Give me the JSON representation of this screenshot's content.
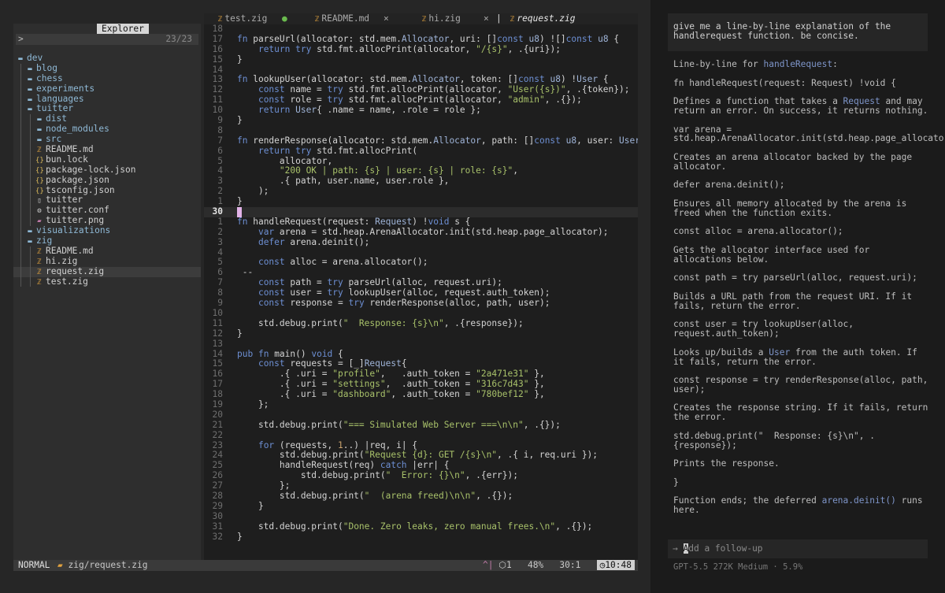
{
  "explorer": {
    "title": "Explorer",
    "search_prompt": ">",
    "count": "23/23",
    "items": [
      {
        "label": "dev",
        "kind": "folder",
        "depth": 0
      },
      {
        "label": "blog",
        "kind": "folder",
        "depth": 1
      },
      {
        "label": "chess",
        "kind": "folder",
        "depth": 1
      },
      {
        "label": "experiments",
        "kind": "folder",
        "depth": 1
      },
      {
        "label": "languages",
        "kind": "folder",
        "depth": 1
      },
      {
        "label": "tuitter",
        "kind": "folder",
        "depth": 1
      },
      {
        "label": "dist",
        "kind": "folder",
        "depth": 2
      },
      {
        "label": "node_modules",
        "kind": "folder",
        "depth": 2
      },
      {
        "label": "src",
        "kind": "folder",
        "depth": 2
      },
      {
        "label": "README.md",
        "kind": "md",
        "depth": 2
      },
      {
        "label": "bun.lock",
        "kind": "json",
        "depth": 2
      },
      {
        "label": "package-lock.json",
        "kind": "json",
        "depth": 2
      },
      {
        "label": "package.json",
        "kind": "json",
        "depth": 2
      },
      {
        "label": "tsconfig.json",
        "kind": "json",
        "depth": 2
      },
      {
        "label": "tuitter",
        "kind": "file",
        "depth": 2
      },
      {
        "label": "tuitter.conf",
        "kind": "gear",
        "depth": 2
      },
      {
        "label": "tuitter.png",
        "kind": "image",
        "depth": 2
      },
      {
        "label": "visualizations",
        "kind": "folder",
        "depth": 1
      },
      {
        "label": "zig",
        "kind": "folder",
        "depth": 1
      },
      {
        "label": "README.md",
        "kind": "md",
        "depth": 2
      },
      {
        "label": "hi.zig",
        "kind": "zig",
        "depth": 2
      },
      {
        "label": "request.zig",
        "kind": "zig",
        "depth": 2,
        "active": true
      },
      {
        "label": "test.zig",
        "kind": "zig",
        "depth": 2
      }
    ]
  },
  "tabs": [
    {
      "label": "test.zig",
      "modified": true
    },
    {
      "label": "README.md",
      "close": "×"
    },
    {
      "label": "hi.zig",
      "close": "×"
    },
    {
      "label": "request.zig",
      "active": true
    }
  ],
  "editor": {
    "current_line": 30,
    "lines": [
      {
        "n": "18",
        "code": ""
      },
      {
        "n": "17",
        "code": "fn parseUrl(allocator: std.mem.Allocator, uri: []const u8) ![]const u8 {"
      },
      {
        "n": "16",
        "code": "    return try std.fmt.allocPrint(allocator, \"/{s}\", .{uri});"
      },
      {
        "n": "15",
        "code": "}"
      },
      {
        "n": "14",
        "code": ""
      },
      {
        "n": "13",
        "code": "fn lookupUser(allocator: std.mem.Allocator, token: []const u8) !User {"
      },
      {
        "n": "12",
        "code": "    const name = try std.fmt.allocPrint(allocator, \"User({s})\", .{token});"
      },
      {
        "n": "11",
        "code": "    const role = try std.fmt.allocPrint(allocator, \"admin\", .{});"
      },
      {
        "n": "10",
        "code": "    return User{ .name = name, .role = role };"
      },
      {
        "n": "9",
        "code": "}"
      },
      {
        "n": "8",
        "code": ""
      },
      {
        "n": "7",
        "code": "fn renderResponse(allocator: std.mem.Allocator, path: []const u8, user: User) ![]const"
      },
      {
        "n": "6",
        "code": "    return try std.fmt.allocPrint("
      },
      {
        "n": "5",
        "code": "        allocator,"
      },
      {
        "n": "4",
        "code": "        \"200 OK | path: {s} | user: {s} | role: {s}\","
      },
      {
        "n": "3",
        "code": "        .{ path, user.name, user.role },"
      },
      {
        "n": "2",
        "code": "    );"
      },
      {
        "n": "1",
        "code": "}"
      },
      {
        "n": "30",
        "code": "",
        "current": true
      },
      {
        "n": "1",
        "code": "fn handleRequest(request: Request) !void s {"
      },
      {
        "n": "2",
        "code": "    var arena = std.heap.ArenaAllocator.init(std.heap.page_allocator);"
      },
      {
        "n": "3",
        "code": "    defer arena.deinit();"
      },
      {
        "n": "4",
        "code": ""
      },
      {
        "n": "5",
        "code": "    const alloc = arena.allocator();"
      },
      {
        "n": "6",
        "code": " --"
      },
      {
        "n": "7",
        "code": "    const path = try parseUrl(alloc, request.uri);"
      },
      {
        "n": "8",
        "code": "    const user = try lookupUser(alloc, request.auth_token);"
      },
      {
        "n": "9",
        "code": "    const response = try renderResponse(alloc, path, user);"
      },
      {
        "n": "10",
        "code": ""
      },
      {
        "n": "11",
        "code": "    std.debug.print(\"  Response: {s}\\n\", .{response});"
      },
      {
        "n": "12",
        "code": "}"
      },
      {
        "n": "13",
        "code": ""
      },
      {
        "n": "14",
        "code": "pub fn main() void {"
      },
      {
        "n": "15",
        "code": "    const requests = [_]Request{"
      },
      {
        "n": "16",
        "code": "        .{ .uri = \"profile\",   .auth_token = \"2a471e31\" },"
      },
      {
        "n": "17",
        "code": "        .{ .uri = \"settings\",  .auth_token = \"316c7d43\" },"
      },
      {
        "n": "18",
        "code": "        .{ .uri = \"dashboard\", .auth_token = \"780bef12\" },"
      },
      {
        "n": "19",
        "code": "    };"
      },
      {
        "n": "20",
        "code": ""
      },
      {
        "n": "21",
        "code": "    std.debug.print(\"=== Simulated Web Server ===\\n\\n\", .{});"
      },
      {
        "n": "22",
        "code": ""
      },
      {
        "n": "23",
        "code": "    for (requests, 1..) |req, i| {"
      },
      {
        "n": "24",
        "code": "        std.debug.print(\"Request {d}: GET /{s}\\n\", .{ i, req.uri });"
      },
      {
        "n": "25",
        "code": "        handleRequest(req) catch |err| {"
      },
      {
        "n": "26",
        "code": "            std.debug.print(\"  Error: {}\\n\", .{err});"
      },
      {
        "n": "27",
        "code": "        };"
      },
      {
        "n": "28",
        "code": "        std.debug.print(\"  (arena freed)\\n\\n\", .{});"
      },
      {
        "n": "29",
        "code": "    }"
      },
      {
        "n": "30",
        "code": ""
      },
      {
        "n": "31",
        "code": "    std.debug.print(\"Done. Zero leaks, zero manual frees.\\n\", .{});"
      },
      {
        "n": "32",
        "code": "}"
      }
    ]
  },
  "statusbar": {
    "mode": "NORMAL",
    "path": "zig/request.zig",
    "git_icon": "^|",
    "diagnostics": "1",
    "percent": "48%",
    "position": "30:1",
    "clock": "10:48"
  },
  "chat": {
    "user_message": "give me a line-by-line explanation of the handlerequest function. be concise.",
    "response": [
      "Line-by-line for handleRequest:",
      "fn handleRequest(request: Request) !void {",
      "Defines a function that takes a Request and may return an error. On success, it returns nothing.",
      "var arena = std.heap.ArenaAllocator.init(std.heap.page_allocator);",
      "Creates an arena allocator backed by the page allocator.",
      "defer arena.deinit();",
      "Ensures all memory allocated by the arena is freed when the function exits.",
      "const alloc = arena.allocator();",
      "Gets the allocator interface used for allocations below.",
      "const path = try parseUrl(alloc, request.uri);",
      "Builds a URL path from the request URI. If it fails, return the error.",
      "const user = try lookupUser(alloc, request.auth_token);",
      "Looks up/builds a User from the auth token. If it fails, return the error.",
      "const response = try renderResponse(alloc, path, user);",
      "Creates the response string. If it fails, return the error.",
      "std.debug.print(\"  Response: {s}\\n\", .{response});",
      "Prints the response.",
      "}",
      "Function ends; the deferred arena.deinit() runs here."
    ],
    "input_prompt": "→",
    "input_placeholder": "Add a follow-up",
    "model_info": "GPT-5.5 272K Medium · 5.9%"
  }
}
